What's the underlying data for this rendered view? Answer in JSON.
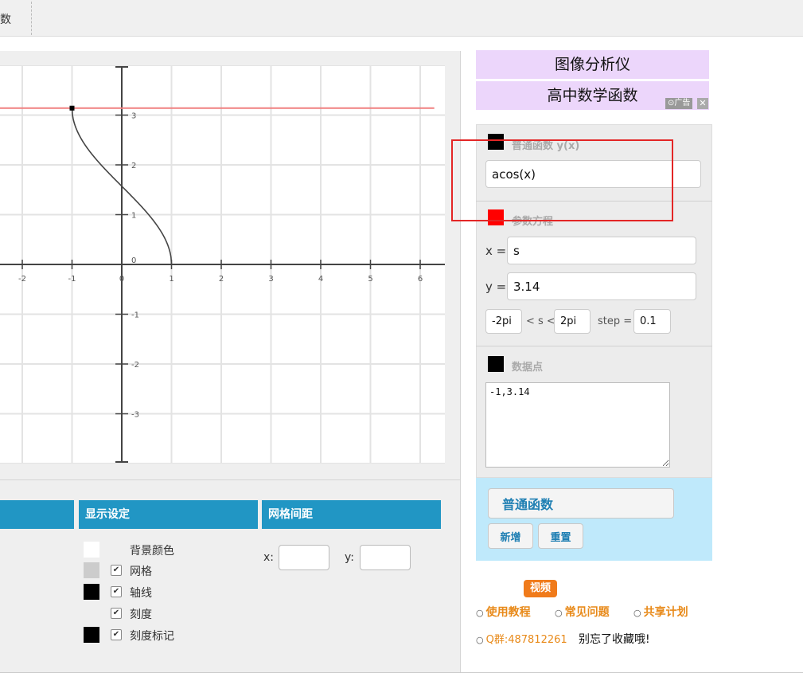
{
  "header": {
    "tab_label": "数"
  },
  "graph": {
    "x_ticks": [
      "-2",
      "-1",
      "0",
      "1",
      "2",
      "3",
      "4",
      "5",
      "6"
    ],
    "y_ticks": [
      "3",
      "2",
      "1",
      "0",
      "-1",
      "-2",
      "-3"
    ],
    "curve_color": "#444444",
    "line_color": "#f08080"
  },
  "sections": {
    "display_settings": "显示设定",
    "grid_spacing": "网格间距"
  },
  "display_options": [
    {
      "label": "背景颜色",
      "swatch": "#ffffff",
      "checked": null
    },
    {
      "label": "网格",
      "swatch": "#cccccc",
      "checked": true
    },
    {
      "label": "轴线",
      "swatch": "#000000",
      "checked": true
    },
    {
      "label": "刻度",
      "swatch": null,
      "checked": true
    },
    {
      "label": "刻度标记",
      "swatch": "#000000",
      "checked": true
    }
  ],
  "grid": {
    "x_label": "x:",
    "y_label": "y:",
    "x_value": "",
    "y_value": ""
  },
  "banners": {
    "analyzer": "图像分析仪",
    "math_functions": "高中数学函数",
    "ad_label": "广告",
    "ad_close": "✕"
  },
  "function_section": {
    "title": "普通函数 y(x)",
    "value": "acos(x)",
    "color": "#000000"
  },
  "parametric_section": {
    "title": "参数方程",
    "color": "#ff0000",
    "x_label": "x =",
    "x_value": "s",
    "y_label": "y =",
    "y_value": "3.14",
    "s_min": "-2pi",
    "s_mid": "< s <",
    "s_max": "2pi",
    "step_label": "step =",
    "step_value": "0.1"
  },
  "points_section": {
    "title": "数据点",
    "color": "#000000",
    "value": "-1,3.14"
  },
  "buttons": {
    "mode": "普通函数",
    "add": "新增",
    "reset": "重置"
  },
  "links": {
    "video_badge": "视频",
    "tutorial": "使用教程",
    "faq": "常见问题",
    "share": "共享计划",
    "qq": "Q群:487812261",
    "remember": "别忘了收藏哦!"
  }
}
